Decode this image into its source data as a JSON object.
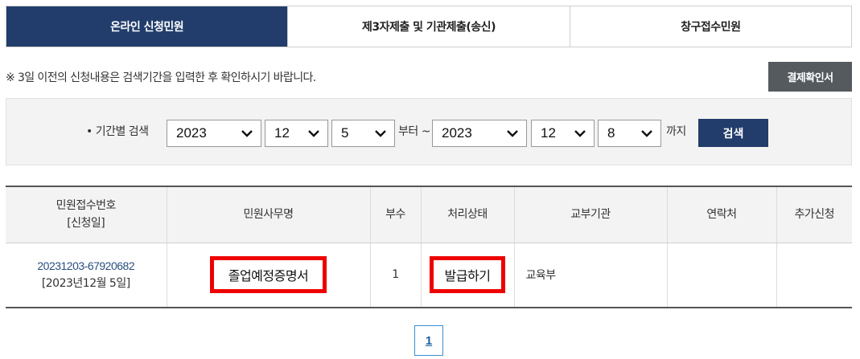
{
  "tabs": [
    {
      "label": "온라인 신청민원",
      "active": true
    },
    {
      "label": "제3자제출 및 기관제출(송신)",
      "active": false
    },
    {
      "label": "창구접수민원",
      "active": false
    }
  ],
  "notice": "※ 3일 이전의 신청내용은 검색기간을 입력한 후 확인하시기 바랍니다.",
  "receipt_button": "결제확인서",
  "search": {
    "label": "• 기간별 검색",
    "from": {
      "year": "2023",
      "month": "12",
      "day": "5"
    },
    "from_suffix": "부터 ~",
    "to": {
      "year": "2023",
      "month": "12",
      "day": "8"
    },
    "to_suffix": "까지",
    "button": "검색"
  },
  "table": {
    "headers": {
      "receipt_no": "민원접수번호",
      "receipt_date": "[신청일]",
      "name": "민원사무명",
      "copies": "부수",
      "status": "처리상태",
      "agency": "교부기관",
      "contact": "연락처",
      "extra": "추가신청"
    },
    "rows": [
      {
        "receipt_no": "20231203-67920682",
        "receipt_date": "[2023년12월 5일]",
        "name": "졸업예정증명서",
        "copies": "1",
        "status": "발급하기",
        "agency": "교육부",
        "contact": "",
        "extra": ""
      }
    ]
  },
  "pagination": {
    "current": "1"
  },
  "colors": {
    "primary": "#223d6b",
    "highlight": "#ee0000",
    "dark_button": "#555a5f",
    "link": "#2a4f80"
  }
}
